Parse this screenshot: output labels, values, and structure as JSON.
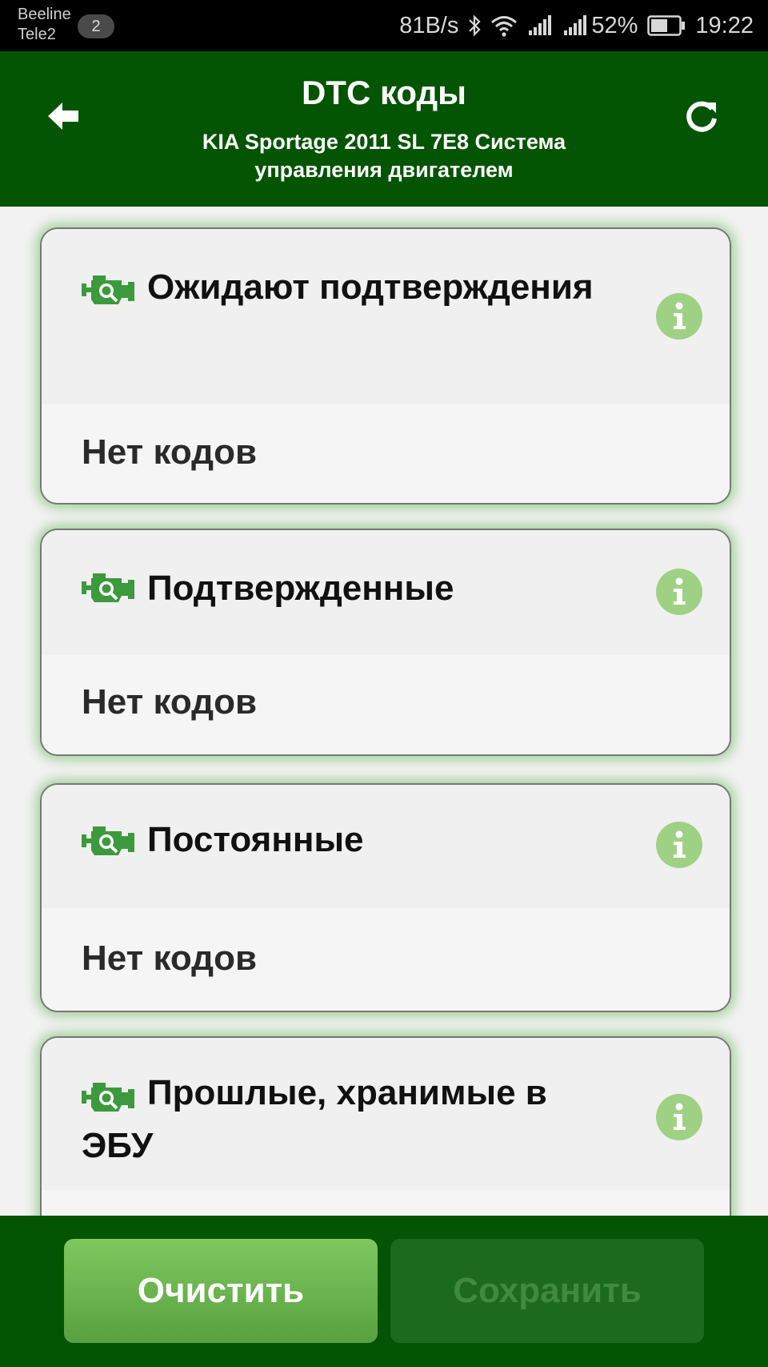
{
  "status_bar": {
    "carrier1": "Beeline",
    "carrier2": "Tele2",
    "notification_count": "2",
    "net_speed": "81B/s",
    "battery": "52%",
    "time": "19:22"
  },
  "header": {
    "title": "DTC коды",
    "subtitle": "KIA Sportage 2011 SL 7E8 Система управления двигателем"
  },
  "cards": [
    {
      "title": "Ожидают подтверждения",
      "body": "Нет кодов"
    },
    {
      "title": "Подтвержденные",
      "body": "Нет кодов"
    },
    {
      "title": "Постоянные",
      "body": "Нет кодов"
    },
    {
      "title": "Прошлые, хранимые в ЭБУ",
      "body": ""
    }
  ],
  "footer": {
    "clear_label": "Очистить",
    "save_label": "Сохранить"
  },
  "colors": {
    "primary": "#035403",
    "icon_green": "#3c9a3c",
    "info_green": "#9fd184",
    "button_green": "#6cb64f"
  },
  "icons": {
    "back": "arrow-left-icon",
    "refresh": "refresh-icon",
    "engine": "engine-check-icon",
    "info": "info-icon"
  }
}
